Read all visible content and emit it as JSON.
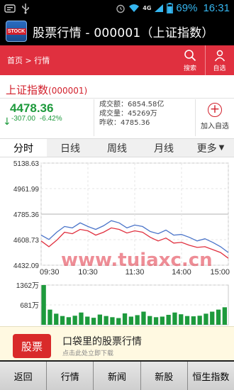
{
  "status_bar": {
    "network": "4G",
    "battery_percent": "69%",
    "time": "16:31"
  },
  "app": {
    "icon_label": "STOCK",
    "title": "股票行情 - 000001（上证指数）"
  },
  "nav": {
    "breadcrumb": "首页 > 行情",
    "search_label": "搜索",
    "self_select_label": "自选"
  },
  "stock": {
    "name": "上证指数",
    "code": "(000001)",
    "price": "4478.36",
    "change": "-307.00",
    "change_pct": "-6.42%",
    "turnover": "成交额：6854.58亿",
    "volume": "成交量：45269万",
    "prev_close": "昨收：4785.36",
    "add_watch_label": "加入自选"
  },
  "tabs": [
    "分时",
    "日线",
    "周线",
    "月线",
    "更多"
  ],
  "chart_data": {
    "type": "line",
    "x_ticks": [
      "09:30",
      "10:30",
      "11:30",
      "14:00",
      "15:00"
    ],
    "y_ticks": [
      "5138.63",
      "4961.99",
      "4785.36",
      "4608.73",
      "4432.09"
    ],
    "ylim": [
      4432.09,
      5138.63
    ],
    "reference_line": 4785.36,
    "series": [
      {
        "color": "#4a74c9",
        "x": [
          "09:30",
          "09:40",
          "09:50",
          "10:00",
          "10:10",
          "10:20",
          "10:30",
          "10:40",
          "10:50",
          "11:00",
          "11:10",
          "11:20",
          "11:30",
          "13:10",
          "13:20",
          "13:30",
          "13:40",
          "13:50",
          "14:00",
          "14:10",
          "14:20",
          "14:30",
          "14:40",
          "14:50",
          "15:00"
        ],
        "values": [
          4640,
          4610,
          4660,
          4700,
          4690,
          4725,
          4700,
          4680,
          4705,
          4740,
          4725,
          4690,
          4710,
          4700,
          4665,
          4650,
          4675,
          4640,
          4645,
          4625,
          4600,
          4615,
          4590,
          4560,
          4520
        ]
      },
      {
        "color": "#e0303f",
        "x": [
          "09:30",
          "09:40",
          "09:50",
          "10:00",
          "10:10",
          "10:20",
          "10:30",
          "10:40",
          "10:50",
          "11:00",
          "11:10",
          "11:20",
          "11:30",
          "13:10",
          "13:20",
          "13:30",
          "13:40",
          "13:50",
          "14:00",
          "14:10",
          "14:20",
          "14:30",
          "14:40",
          "14:50",
          "15:00"
        ],
        "values": [
          4600,
          4560,
          4605,
          4660,
          4650,
          4680,
          4670,
          4640,
          4660,
          4690,
          4680,
          4655,
          4670,
          4660,
          4625,
          4600,
          4620,
          4585,
          4590,
          4570,
          4555,
          4560,
          4540,
          4520,
          4480
        ]
      }
    ],
    "volume_ticks": [
      "1362万",
      "681万"
    ],
    "volume_color": "#1d9a3c",
    "volume_values": [
      1362,
      520,
      380,
      300,
      260,
      310,
      420,
      280,
      240,
      350,
      300,
      260,
      230,
      390,
      280,
      330,
      450,
      300,
      260,
      280,
      340,
      420,
      360,
      300,
      290,
      310,
      380,
      450,
      520,
      600
    ]
  },
  "watermark": "www.tuiaxc.cn",
  "ad": {
    "logo_text": "股票",
    "title": "口袋里的股票行情",
    "subtitle": "点击此处立即下载"
  },
  "bottom_nav": [
    "返回",
    "行情",
    "新闻",
    "新股",
    "恒生指数"
  ]
}
